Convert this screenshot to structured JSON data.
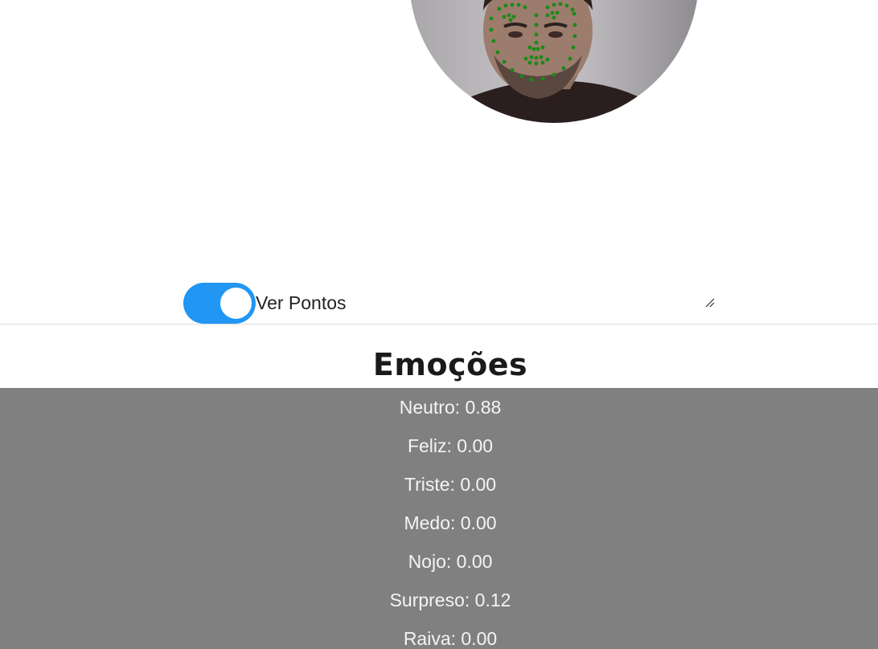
{
  "toggle": {
    "label": "Ver Pontos",
    "checked": true,
    "on_color": "#2196f3"
  },
  "emotions": {
    "title": "Emoções",
    "panel_color": "#808080",
    "items": [
      {
        "label": "Neutro: 0.88"
      },
      {
        "label": "Feliz: 0.00"
      },
      {
        "label": "Triste: 0.00"
      },
      {
        "label": "Medo: 0.00"
      },
      {
        "label": "Nojo: 0.00"
      },
      {
        "label": "Surpreso: 0.12"
      },
      {
        "label": "Raiva: 0.00"
      }
    ]
  },
  "webcam": {
    "landmark_color": "#1a8a1a"
  }
}
